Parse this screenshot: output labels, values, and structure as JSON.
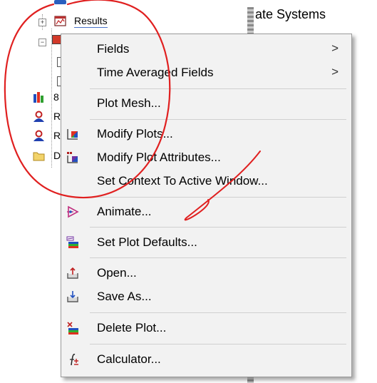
{
  "tree": {
    "results_label": "Results",
    "partial_items": [
      "8",
      "R",
      "R",
      "D"
    ]
  },
  "right_panel": {
    "title_fragment": "ate Systems"
  },
  "menu": {
    "items": [
      {
        "label": "Fields",
        "icon": "none",
        "submenu": true
      },
      {
        "label": "Time Averaged Fields",
        "icon": "none",
        "submenu": true
      },
      {
        "label": "Plot Mesh...",
        "icon": "none"
      },
      {
        "label": "Modify Plots...",
        "icon": "modify-plots-icon"
      },
      {
        "label": "Modify Plot Attributes...",
        "icon": "modify-attributes-icon"
      },
      {
        "label": "Set Context To Active Window...",
        "icon": "none"
      },
      {
        "label": "Animate...",
        "icon": "animate-icon"
      },
      {
        "label": "Set Plot Defaults...",
        "icon": "plot-defaults-icon"
      },
      {
        "label": "Open...",
        "icon": "open-icon"
      },
      {
        "label": "Save As...",
        "icon": "save-as-icon"
      },
      {
        "label": "Delete Plot...",
        "icon": "delete-plot-icon"
      },
      {
        "label": "Calculator...",
        "icon": "calculator-icon"
      }
    ],
    "submenu_arrow": ">"
  },
  "colors": {
    "menu_bg": "#f2f2f2",
    "annotation_red": "#e02020",
    "selection_underline": "#4a74c9"
  }
}
